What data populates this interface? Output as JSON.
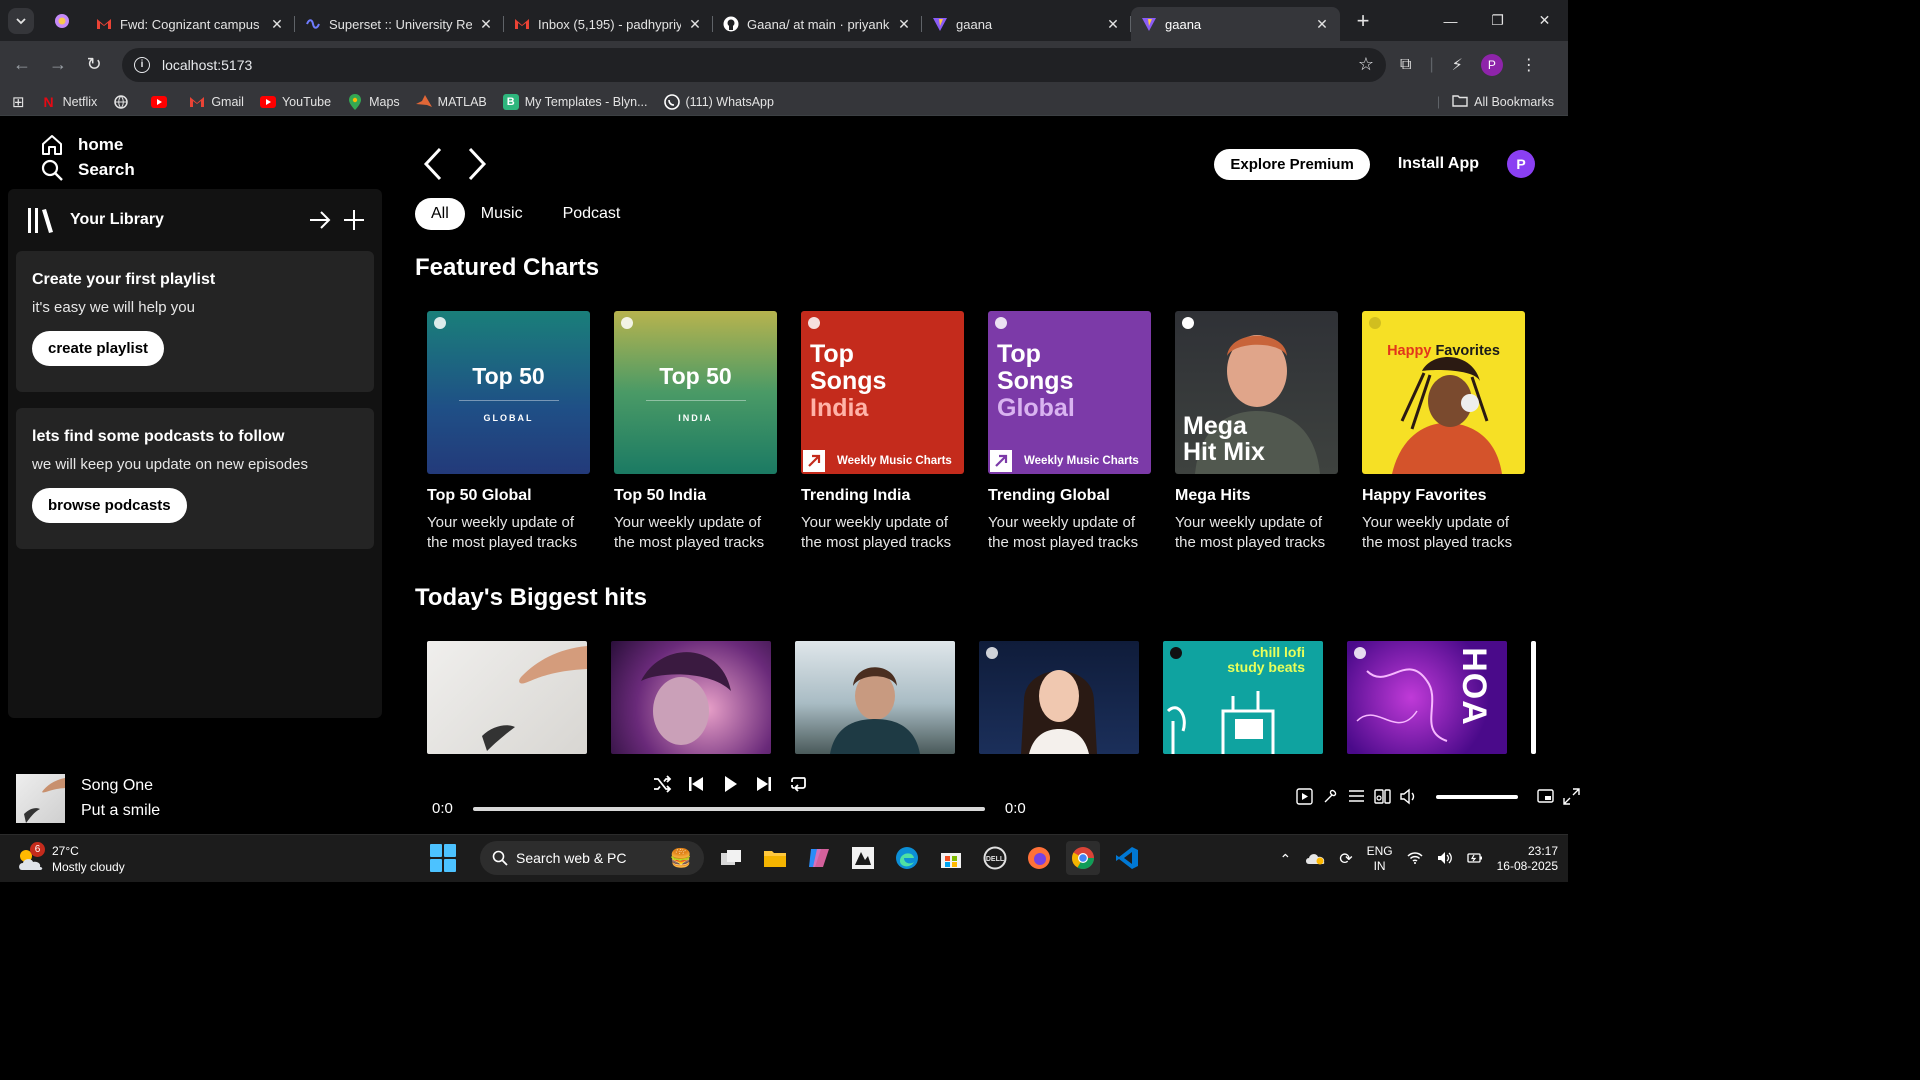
{
  "browser": {
    "tabs": [
      {
        "title": "Fwd: Cognizant campus h"
      },
      {
        "title": "Superset :: University Rec"
      },
      {
        "title": "Inbox (5,195) - padhypriy"
      },
      {
        "title": "Gaana/ at main · priyanka"
      },
      {
        "title": "gaana"
      },
      {
        "title": "gaana"
      }
    ],
    "url": "localhost:5173",
    "profile_initial": "P",
    "bookmarks": [
      "Netflix",
      "Gmail",
      "YouTube",
      "Maps",
      "MATLAB",
      "My Templates - Blyn...",
      "(111) WhatsApp"
    ],
    "all_bookmarks": "All Bookmarks"
  },
  "sidebar": {
    "home": "home",
    "search": "Search",
    "library_title": "Your Library",
    "playlist_card": {
      "title": "Create your first playlist",
      "text": "it's easy we will help you",
      "button": "create playlist"
    },
    "podcast_card": {
      "title": "lets find some podcasts to follow",
      "text": "we will keep you update on new episodes",
      "button": "browse podcasts"
    }
  },
  "topbar": {
    "premium": "Explore Premium",
    "install": "Install App",
    "avatar": "P"
  },
  "filters": [
    "All",
    "Music",
    "Podcast"
  ],
  "featured": {
    "title": "Featured Charts",
    "cards": [
      {
        "name": "Top 50 Global",
        "desc": "Your weekly update of the most played tracks",
        "cover_big": "Top 50",
        "cover_small": "GLOBAL"
      },
      {
        "name": "Top 50 India",
        "desc": "Your weekly update of the most played tracks",
        "cover_big": "Top 50",
        "cover_small": "INDIA"
      },
      {
        "name": "Trending India",
        "desc": "Your weekly update of the most played tracks",
        "cover_l1": "Top",
        "cover_l2": "Songs",
        "cover_l3": "India",
        "cover_foot": "Weekly Music Charts"
      },
      {
        "name": "Trending Global",
        "desc": "Your weekly update of the most played tracks",
        "cover_l1": "Top",
        "cover_l2": "Songs",
        "cover_l3": "Global",
        "cover_foot": "Weekly Music Charts"
      },
      {
        "name": "Mega Hits",
        "desc": "Your weekly update of the most played tracks",
        "cover_l1": "Mega",
        "cover_l2": "Hit Mix"
      },
      {
        "name": "Happy Favorites",
        "desc": "Your weekly update of the most played tracks",
        "cover_l1": "Happy",
        "cover_l2": "Favorites"
      }
    ]
  },
  "hits": {
    "title": "Today's Biggest hits",
    "chill_label_1": "chill lofi",
    "chill_label_2": "study beats",
    "last_label": "HOA"
  },
  "player": {
    "song": "Song One",
    "artist": "Put a smile",
    "current": "0:0",
    "total": "0:0"
  },
  "taskbar": {
    "temp": "27°C",
    "weather": "Mostly cloudy",
    "weather_badge": "6",
    "search": "Search web & PC",
    "lang1": "ENG",
    "lang2": "IN",
    "time": "23:17",
    "date": "16-08-2025"
  }
}
